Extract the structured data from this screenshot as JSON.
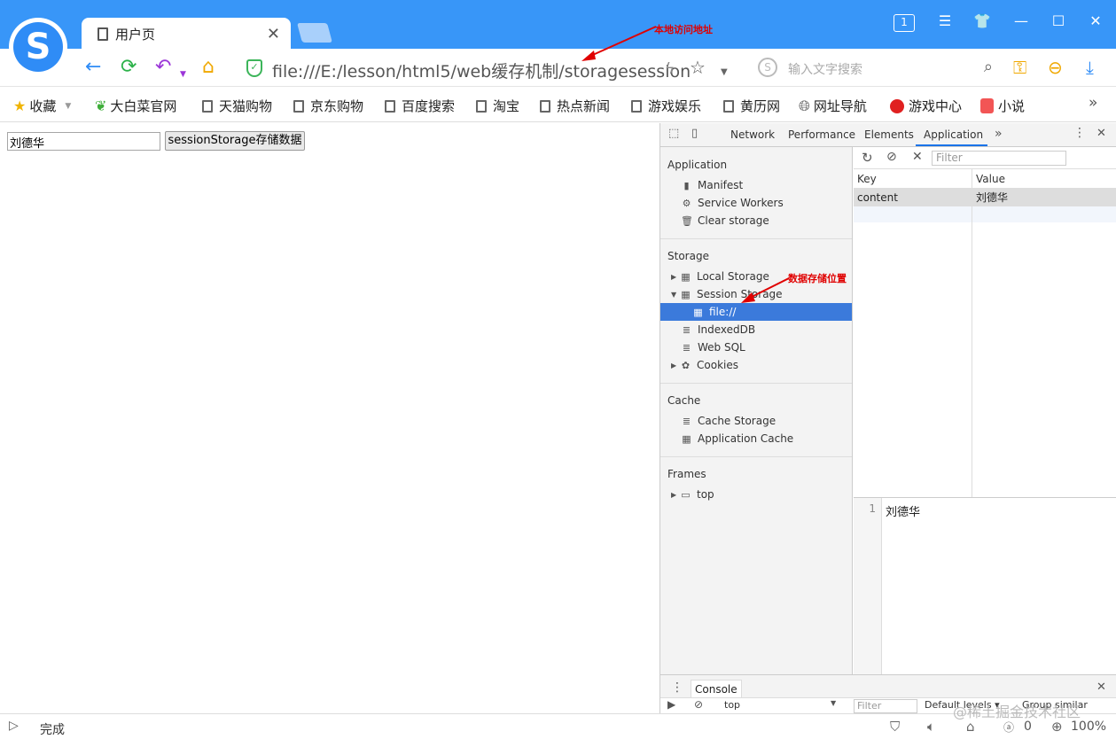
{
  "browser": {
    "tab_title": "用户页",
    "tab_close": "✕",
    "tab_count_badge": "1",
    "url": "file:///E:/lesson/html5/web缓存机制/storagesession",
    "search_placeholder": "输入文字搜索",
    "accent_color": "#3896f8"
  },
  "bookmarks": [
    {
      "label": "收藏",
      "icon": "star-icon"
    },
    {
      "label": "大白菜官网",
      "icon": "cabbage-icon"
    },
    {
      "label": "天猫购物",
      "icon": "page-icon"
    },
    {
      "label": "京东购物",
      "icon": "page-icon"
    },
    {
      "label": "百度搜索",
      "icon": "page-icon"
    },
    {
      "label": "淘宝",
      "icon": "page-icon"
    },
    {
      "label": "热点新闻",
      "icon": "page-icon"
    },
    {
      "label": "游戏娱乐",
      "icon": "page-icon"
    },
    {
      "label": "黄历网",
      "icon": "page-icon"
    },
    {
      "label": "网址导航",
      "icon": "globe-icon"
    },
    {
      "label": "游戏中心",
      "icon": "game-icon"
    },
    {
      "label": "小说",
      "icon": "book-icon"
    }
  ],
  "bookmarks_more": "»",
  "page": {
    "input_value": "刘德华",
    "button_label": "sessionStorage存储数据"
  },
  "devtools": {
    "tabs": [
      "Network",
      "Performance",
      "Elements",
      "Application"
    ],
    "active_tab": "Application",
    "more": "»",
    "sidebar": {
      "application_header": "Application",
      "application_items": [
        "Manifest",
        "Service Workers",
        "Clear storage"
      ],
      "storage_header": "Storage",
      "storage_items": [
        "Local Storage",
        "Session Storage",
        "file://",
        "IndexedDB",
        "Web SQL",
        "Cookies"
      ],
      "cache_header": "Cache",
      "cache_items": [
        "Cache Storage",
        "Application Cache"
      ],
      "frames_header": "Frames",
      "frames_items": [
        "top"
      ]
    },
    "filter_placeholder": "Filter",
    "table": {
      "headers": [
        "Key",
        "Value"
      ],
      "rows": [
        {
          "key": "content",
          "value": "刘德华"
        }
      ]
    },
    "preview": {
      "line": "1",
      "text": "刘德华"
    },
    "drawer": {
      "tab": "Console",
      "context": "top",
      "filter": "Filter",
      "levels": "Default levels ▾",
      "group": "Group similar"
    }
  },
  "annotations": {
    "url_note": "本地访问地址",
    "storage_note": "数据存储位置"
  },
  "status": {
    "text": "完成",
    "counter": "0",
    "zoom": "100%"
  },
  "watermark": "@稀土掘金技术社区"
}
